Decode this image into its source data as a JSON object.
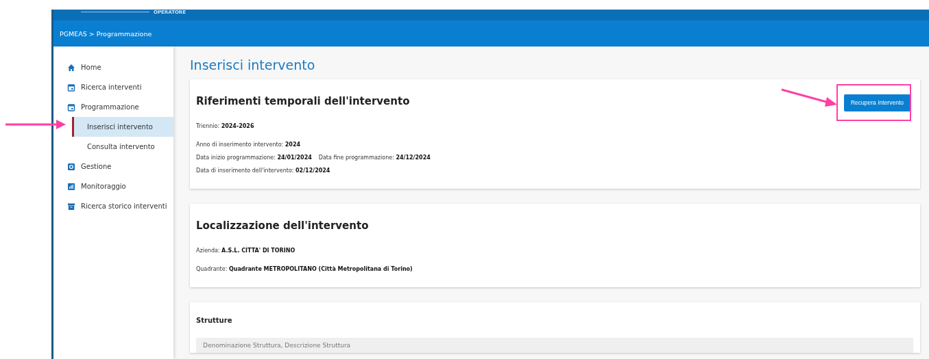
{
  "header": {
    "role": "OPERATORE"
  },
  "breadcrumb": "PGMEAS > Programmazione",
  "sidebar": {
    "items": [
      {
        "label": "Home",
        "selected": false
      },
      {
        "label": "Ricerca interventi",
        "selected": false
      },
      {
        "label": "Programmazione",
        "selected": false,
        "children": [
          {
            "label": "Inserisci intervento",
            "selected": true
          },
          {
            "label": "Consulta intervento",
            "selected": false
          }
        ]
      },
      {
        "label": "Gestione",
        "selected": false
      },
      {
        "label": "Monitoraggio",
        "selected": false
      },
      {
        "label": "Ricerca storico interventi",
        "selected": false
      }
    ]
  },
  "page_title": "Inserisci intervento",
  "cards": [
    {
      "title": "Riferimenti temporali dell'intervento",
      "button": "Recupera Intervento",
      "rows": [
        [
          "Triennio: **2024-2026**"
        ],
        [
          "Anno di inserimento intervento: **2024**"
        ],
        [
          "Data inizio programmazione: **24/01/2024**",
          "Data fine programmazione: **24/12/2024**"
        ],
        [
          "Data di inserimento dell'intervento: **02/12/2024**"
        ]
      ]
    },
    {
      "title": "Localizzazione dell'intervento",
      "rows": [
        [
          "Azienda: **A.S.L. CITTA' DI TORINO**"
        ],
        [
          "Quadrante: **Quadrante METROPOLITANO (Città Metropolitana di Torino)**"
        ]
      ]
    },
    {
      "title": "Strutture",
      "field": {
        "placeholder": "Denominazione Struttura, Descrizione Struttura"
      }
    }
  ]
}
